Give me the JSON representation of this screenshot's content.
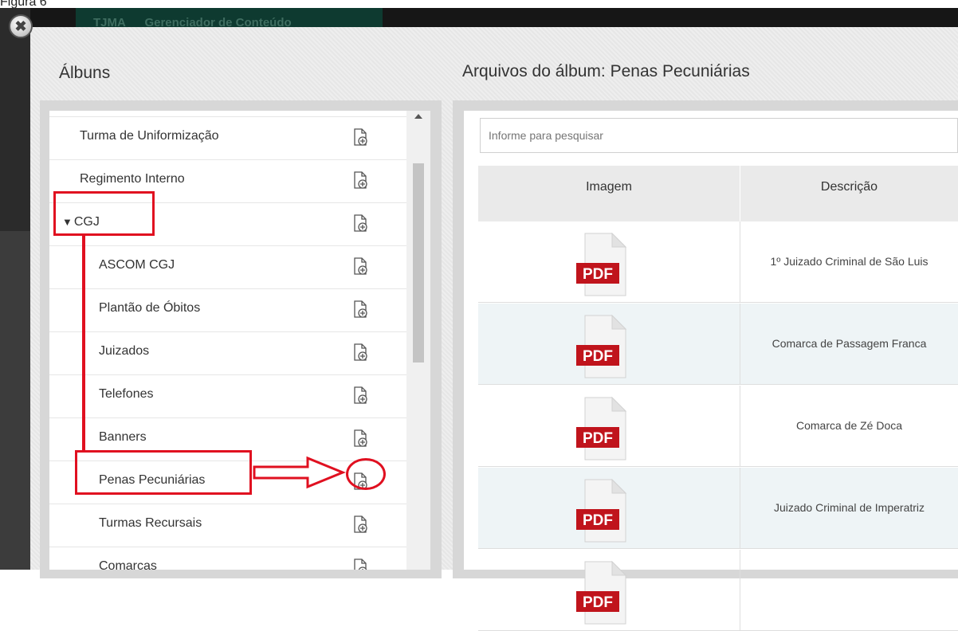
{
  "figure_caption": "Figura 6",
  "background_nav": {
    "site": "TJMA",
    "section": "Gerenciador de Conteúdo"
  },
  "close_button": {
    "glyph": "✖",
    "icon": "close-icon"
  },
  "albums_panel": {
    "title": "Álbuns",
    "items": [
      {
        "label": "Turma de Uniformização",
        "level": 0,
        "icon": "add-file-icon"
      },
      {
        "label": "Regimento Interno",
        "level": 0,
        "icon": "add-file-icon"
      },
      {
        "label": "CGJ",
        "level": 0,
        "expanded": true,
        "toggle": "▼",
        "icon": "add-file-icon"
      },
      {
        "label": "ASCOM CGJ",
        "level": 1,
        "icon": "add-file-icon"
      },
      {
        "label": "Plantão de Óbitos",
        "level": 1,
        "icon": "add-file-icon"
      },
      {
        "label": "Juizados",
        "level": 1,
        "icon": "add-file-icon"
      },
      {
        "label": "Telefones",
        "level": 1,
        "icon": "add-file-icon"
      },
      {
        "label": "Banners",
        "level": 1,
        "icon": "add-file-icon"
      },
      {
        "label": "Penas Pecuniárias",
        "level": 1,
        "icon": "add-file-icon",
        "highlighted": true
      },
      {
        "label": "Turmas Recursais",
        "level": 1,
        "icon": "add-file-icon"
      },
      {
        "label": "Comarcas",
        "level": 1,
        "icon": "add-file-icon"
      }
    ]
  },
  "files_panel": {
    "title": "Arquivos do álbum: Penas Pecuniárias",
    "search": {
      "placeholder": "Informe para pesquisar",
      "value": ""
    },
    "table": {
      "columns": [
        "Imagem",
        "Descrição"
      ],
      "rows": [
        {
          "image": "PDF",
          "description": "1º Juizado Criminal de São Luis"
        },
        {
          "image": "PDF",
          "description": "Comarca de Passagem Franca"
        },
        {
          "image": "PDF",
          "description": "Comarca de Zé Doca"
        },
        {
          "image": "PDF",
          "description": "Juizado Criminal de Imperatriz"
        },
        {
          "image": "PDF",
          "description": ""
        }
      ]
    }
  },
  "colors": {
    "annotation_red": "#e01020",
    "pdf_red": "#c0141c",
    "row_alt": "#eef4f6"
  }
}
